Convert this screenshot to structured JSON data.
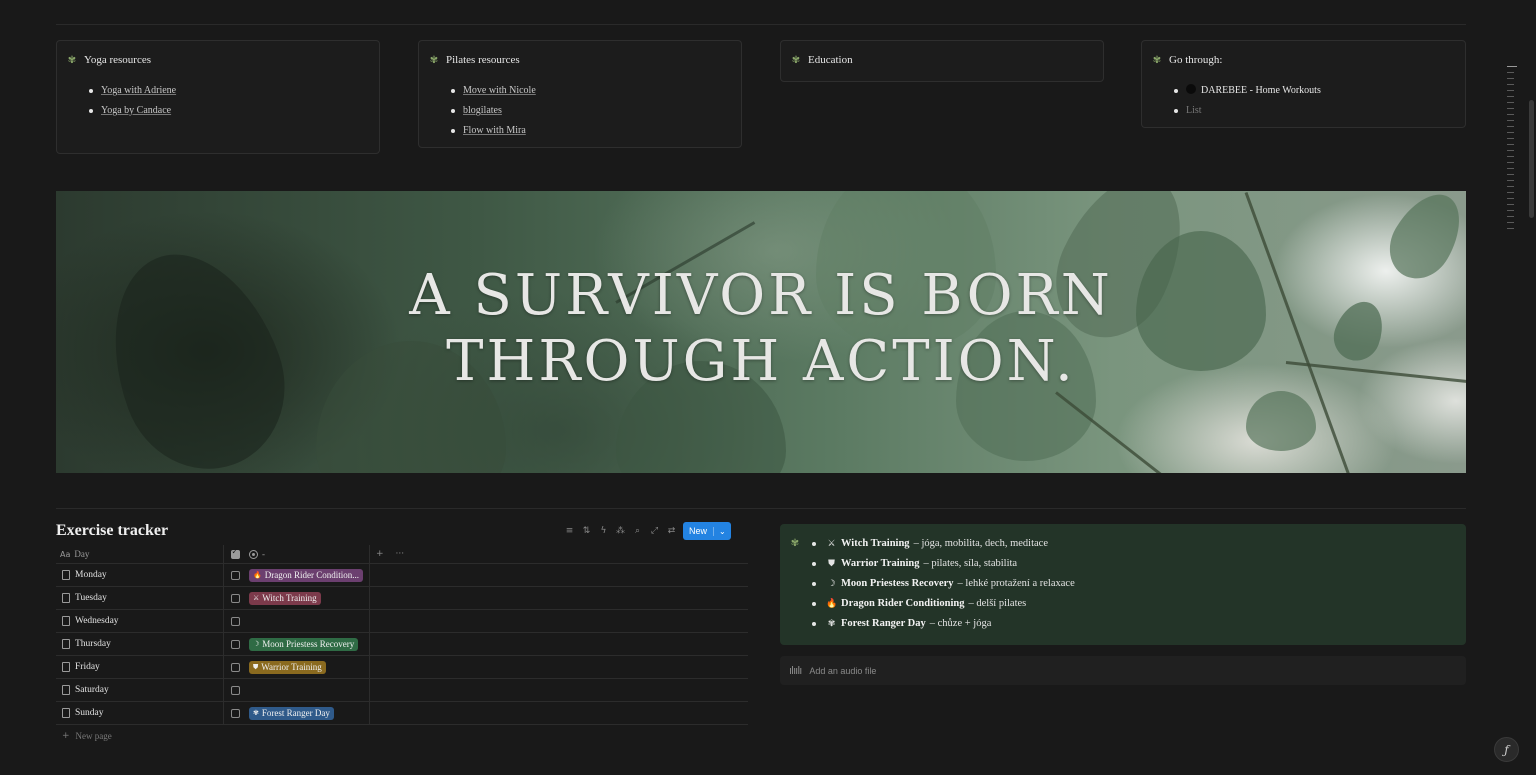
{
  "resource_cards": [
    {
      "title": "Yoga resources",
      "items": [
        {
          "text": "Yoga with Adriene",
          "style": "link"
        },
        {
          "text": "Yoga by Candace",
          "style": "link"
        }
      ]
    },
    {
      "title": "Pilates resources",
      "items": [
        {
          "text": "Move with Nicole",
          "style": "link"
        },
        {
          "text": "blogilates",
          "style": "link"
        },
        {
          "text": "Flow with Mira",
          "style": "link"
        }
      ]
    },
    {
      "title": "Education",
      "items": []
    },
    {
      "title": "Go through:",
      "items": [
        {
          "text": "DAREBEE - Home Workouts",
          "style": "plain"
        },
        {
          "text": "List",
          "style": "muted"
        }
      ]
    }
  ],
  "banner": {
    "line1": "A SURVIVOR IS BORN",
    "line2": "THROUGH ACTION."
  },
  "tracker": {
    "title": "Exercise tracker",
    "new_label": "New",
    "header": {
      "day": "Day",
      "tag": "-",
      "add": "+",
      "more": "···",
      "day_icon": "Aa"
    },
    "rows": [
      {
        "day": "Monday",
        "tag": "Dragon Rider Condition...",
        "emoji": "🔥",
        "color": "#6b3f6f"
      },
      {
        "day": "Tuesday",
        "tag": "Witch Training",
        "emoji": "⚔",
        "color": "#7c3a4b"
      },
      {
        "day": "Wednesday",
        "tag": "",
        "emoji": "",
        "color": ""
      },
      {
        "day": "Thursday",
        "tag": "Moon Priestess Recovery",
        "emoji": "☽",
        "color": "#2f6b45"
      },
      {
        "day": "Friday",
        "tag": "Warrior Training",
        "emoji": "⛊",
        "color": "#8a6a1f"
      },
      {
        "day": "Saturday",
        "tag": "",
        "emoji": "",
        "color": ""
      },
      {
        "day": "Sunday",
        "tag": "Forest Ranger Day",
        "emoji": "✾",
        "color": "#2f5a8a"
      }
    ],
    "new_page": "New page"
  },
  "legend": [
    {
      "emoji": "⚔",
      "name": "Witch Training",
      "desc": "– jóga, mobilita, dech, meditace"
    },
    {
      "emoji": "⛊",
      "name": "Warrior Training",
      "desc": "– pilates, síla, stabilita"
    },
    {
      "emoji": "☽",
      "name": "Moon Priestess Recovery",
      "desc": "– lehké protažení a relaxace"
    },
    {
      "emoji": "🔥",
      "name": "Dragon Rider Conditioning",
      "desc": "– delší pilates"
    },
    {
      "emoji": "✾",
      "name": "Forest Ranger Day",
      "desc": "– chůze + jóga"
    }
  ],
  "audio": {
    "label": "Add an audio file"
  },
  "colors": {
    "accent": "#2383e2",
    "callout_bg": "#233428",
    "sprout": "#8ba86a"
  }
}
